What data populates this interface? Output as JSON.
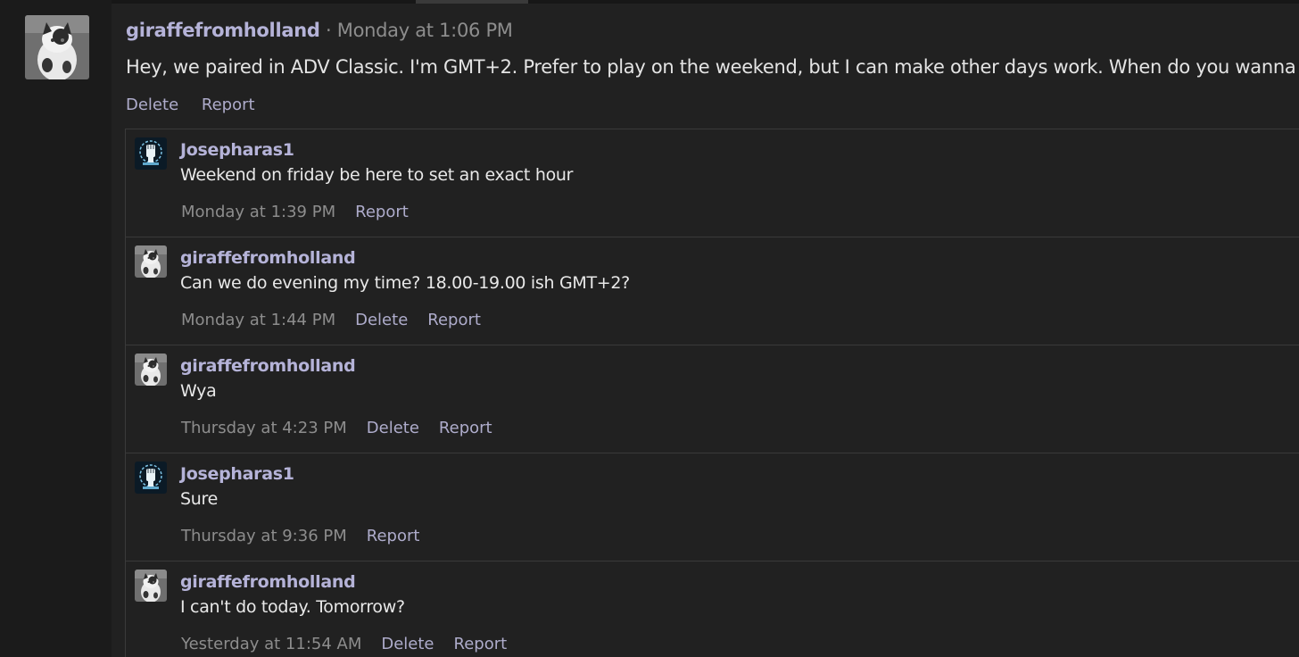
{
  "post": {
    "author": "giraffefromholland",
    "separator": " · ",
    "time": "Monday at 1:06 PM",
    "text": "Hey, we paired in ADV Classic. I'm GMT+2. Prefer to play on the weekend, but I can make other days work. When do you wanna go?",
    "actions": {
      "delete": "Delete",
      "report": "Report"
    }
  },
  "comments": [
    {
      "author": "Josepharas1",
      "avatar": "fist-avatar-icon",
      "text": "Weekend on friday be here to set an exact hour",
      "time": "Monday at 1:39 PM",
      "delete": "",
      "report": "Report"
    },
    {
      "author": "giraffefromholland",
      "avatar": "cat-avatar-icon",
      "text": "Can we do evening my time? 18.00-19.00 ish GMT+2?",
      "time": "Monday at 1:44 PM",
      "delete": "Delete",
      "report": "Report"
    },
    {
      "author": "giraffefromholland",
      "avatar": "cat-avatar-icon",
      "text": "Wya",
      "time": "Thursday at 4:23 PM",
      "delete": "Delete",
      "report": "Report"
    },
    {
      "author": "Josepharas1",
      "avatar": "fist-avatar-icon",
      "text": "Sure",
      "time": "Thursday at 9:36 PM",
      "delete": "",
      "report": "Report"
    },
    {
      "author": "giraffefromholland",
      "avatar": "cat-avatar-icon",
      "text": "I can't do today. Tomorrow?",
      "time": "Yesterday at 11:54 AM",
      "delete": "Delete",
      "report": "Report"
    }
  ],
  "colors": {
    "username": "#b5b3d8",
    "meta": "#8d8d8d",
    "text": "#e4e4e4",
    "background": "#212121"
  }
}
